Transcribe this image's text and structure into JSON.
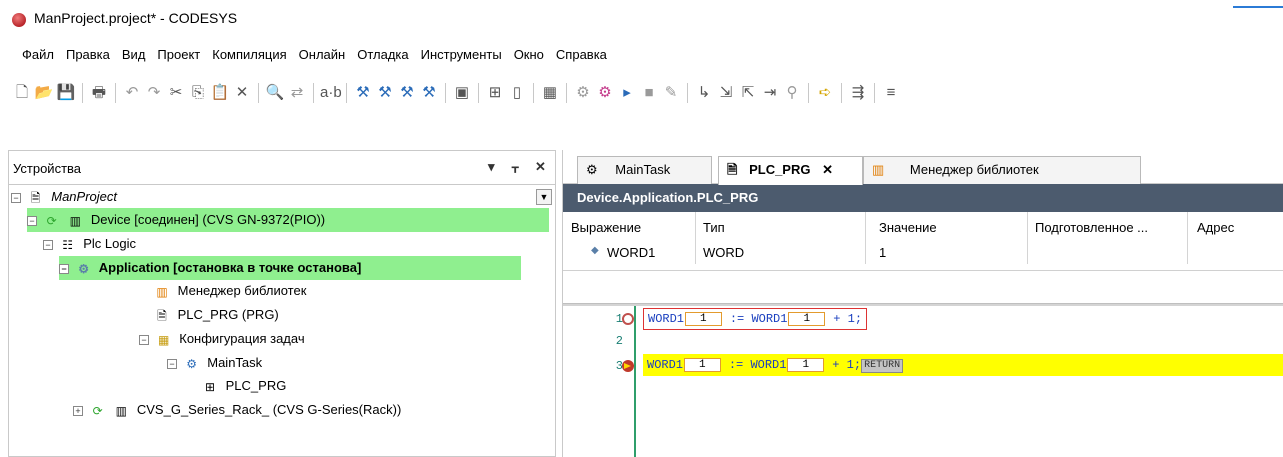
{
  "window": {
    "title": "ManProject.project* - CODESYS"
  },
  "menu": [
    "Файл",
    "Правка",
    "Вид",
    "Проект",
    "Компиляция",
    "Онлайн",
    "Отладка",
    "Инструменты",
    "Окно",
    "Справка"
  ],
  "devices_panel": {
    "title": "Устройства",
    "tree": [
      {
        "label": "ManProject",
        "italic": true
      },
      {
        "label": "Device [соединен] (CVS GN-9372(PIO))",
        "highlight": true
      },
      {
        "label": "Plc Logic"
      },
      {
        "label": "Application [остановка в точке останова]",
        "highlight": true,
        "bold": true
      },
      {
        "label": "Менеджер библиотек"
      },
      {
        "label": "PLC_PRG (PRG)"
      },
      {
        "label": "Конфигурация задач"
      },
      {
        "label": "MainTask"
      },
      {
        "label": "PLC_PRG"
      },
      {
        "label": "CVS_G_Series_Rack_ (CVS G-Series(Rack))"
      }
    ]
  },
  "editor": {
    "tabs": [
      "MainTask",
      "PLC_PRG",
      "Менеджер библиотек"
    ],
    "title": "Device.Application.PLC_PRG",
    "watch_columns": [
      "Выражение",
      "Тип",
      "Значение",
      "Подготовленное ...",
      "Адрес"
    ],
    "watch_rows": [
      {
        "expression": "WORD1",
        "type": "WORD",
        "value": "1"
      }
    ],
    "code_lines": [
      {
        "n": "1",
        "var": "WORD1",
        "mon": "1",
        "op": ":= ",
        "var2": "WORD1",
        "mon2": "1",
        "tail": " + 1;"
      },
      {
        "n": "2"
      },
      {
        "n": "3",
        "var": "WORD1",
        "mon": "1",
        "op": ":= ",
        "var2": "WORD1",
        "mon2": "1",
        "tail": " + 1;",
        "return": "RETURN"
      }
    ]
  }
}
